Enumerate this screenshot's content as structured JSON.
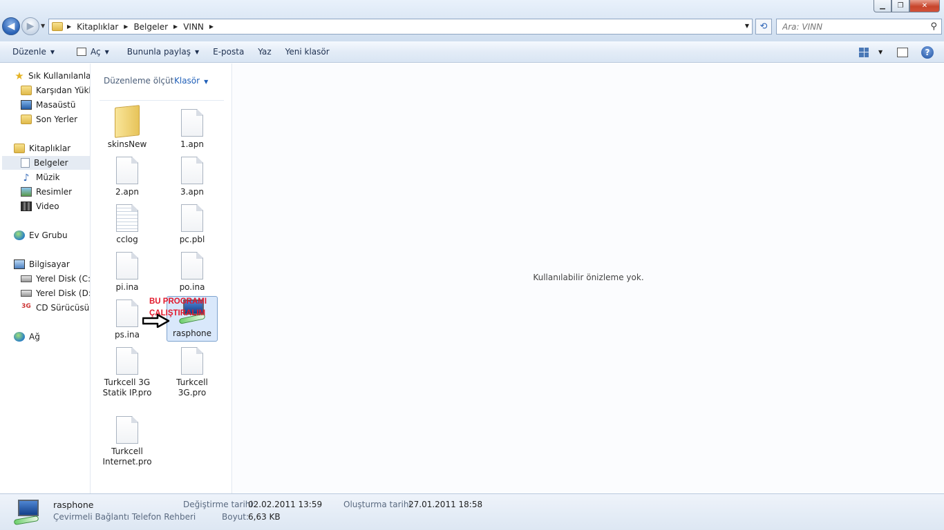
{
  "address": {
    "crumbs": [
      "Kitaplıklar",
      "Belgeler",
      "VINN"
    ]
  },
  "search": {
    "placeholder": "Ara: VINN"
  },
  "toolbar": {
    "organize": "Düzenle",
    "open": "Aç",
    "share": "Bununla paylaş",
    "email": "E-posta",
    "print": "Yaz",
    "new_folder": "Yeni klasör"
  },
  "nav": {
    "favorites": "Sık Kullanılanlar",
    "downloads": "Karşıdan Yüklenenler",
    "desktop": "Masaüstü",
    "recent": "Son Yerler",
    "libraries": "Kitaplıklar",
    "documents": "Belgeler",
    "music": "Müzik",
    "pictures": "Resimler",
    "video": "Video",
    "homegroup": "Ev Grubu",
    "computer": "Bilgisayar",
    "drive_c": "Yerel Disk (C:)",
    "drive_d": "Yerel Disk (D:)",
    "drive_cd": "CD Sürücüsü (F:)",
    "network": "Ağ"
  },
  "arrange": {
    "label": "Düzenleme ölçüt",
    "value": "Klasör"
  },
  "files": [
    {
      "name": "skinsNew",
      "type": "folder"
    },
    {
      "name": "1.apn",
      "type": "file"
    },
    {
      "name": "2.apn",
      "type": "file"
    },
    {
      "name": "3.apn",
      "type": "file"
    },
    {
      "name": "cclog",
      "type": "text"
    },
    {
      "name": "pc.pbl",
      "type": "file"
    },
    {
      "name": "pi.ina",
      "type": "file"
    },
    {
      "name": "po.ina",
      "type": "file"
    },
    {
      "name": "ps.ina",
      "type": "file"
    },
    {
      "name": "rasphone",
      "type": "app",
      "selected": true
    },
    {
      "name": "Turkcell 3G Statik IP.pro",
      "type": "file"
    },
    {
      "name": "Turkcell 3G.pro",
      "type": "file"
    },
    {
      "name": "Turkcell Internet.pro",
      "type": "file"
    }
  ],
  "annotation": {
    "line1": "BU PROGRAMI",
    "line2": "ÇALIŞTIRALIM"
  },
  "preview": {
    "text": "Kullanılabilir önizleme yok."
  },
  "details": {
    "name": "rasphone",
    "type": "Çevirmeli Bağlantı Telefon Rehberi",
    "modified_label": "Değiştirme tarihi:",
    "modified": "02.02.2011 13:59",
    "size_label": "Boyut:",
    "size": "6,63 KB",
    "created_label": "Oluşturma tarihi:",
    "created": "27.01.2011 18:58"
  },
  "colors": {
    "accent": "#1f5fb8",
    "annotation": "#e2182b",
    "selection": "#d9e8fb"
  }
}
